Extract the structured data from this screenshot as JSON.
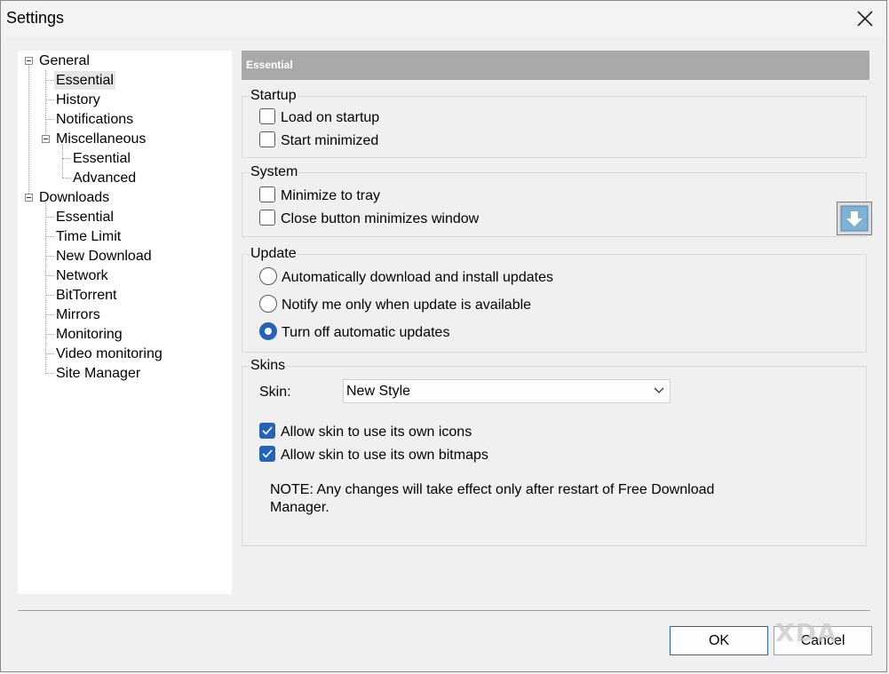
{
  "window": {
    "title": "Settings"
  },
  "tree": {
    "items": [
      {
        "label": "General"
      },
      {
        "label": "Essential"
      },
      {
        "label": "History"
      },
      {
        "label": "Notifications"
      },
      {
        "label": "Miscellaneous"
      },
      {
        "label": "Essential"
      },
      {
        "label": "Advanced"
      },
      {
        "label": "Downloads"
      },
      {
        "label": "Essential"
      },
      {
        "label": "Time Limit"
      },
      {
        "label": "New Download"
      },
      {
        "label": "Network"
      },
      {
        "label": "BitTorrent"
      },
      {
        "label": "Mirrors"
      },
      {
        "label": "Monitoring"
      },
      {
        "label": "Video monitoring"
      },
      {
        "label": "Site Manager"
      }
    ],
    "selected_index": 1
  },
  "panel": {
    "header": "Essential",
    "startup": {
      "label": "Startup",
      "load_on_startup": {
        "label": "Load on startup",
        "checked": false
      },
      "start_minimized": {
        "label": "Start minimized",
        "checked": false
      }
    },
    "system": {
      "label": "System",
      "minimize_to_tray": {
        "label": "Minimize to tray",
        "checked": false
      },
      "close_minimizes": {
        "label": "Close button minimizes window",
        "checked": false
      }
    },
    "update": {
      "label": "Update",
      "options": [
        {
          "label": "Automatically download and install updates",
          "selected": false
        },
        {
          "label": "Notify me only when update is available",
          "selected": false
        },
        {
          "label": "Turn off automatic updates",
          "selected": true
        }
      ]
    },
    "skins": {
      "label": "Skins",
      "skin_label": "Skin:",
      "skin_value": "New Style",
      "own_icons": {
        "label": "Allow skin to use its own icons",
        "checked": true
      },
      "own_bitmaps": {
        "label": "Allow skin to use its own bitmaps",
        "checked": true
      },
      "note": "NOTE: Any changes will take effect only after restart of Free Download Manager."
    }
  },
  "buttons": {
    "ok": "OK",
    "cancel": "Cancel"
  },
  "watermark": "XDA",
  "colors": {
    "accent": "#2563b5",
    "header_bg": "#a9a9a9"
  }
}
